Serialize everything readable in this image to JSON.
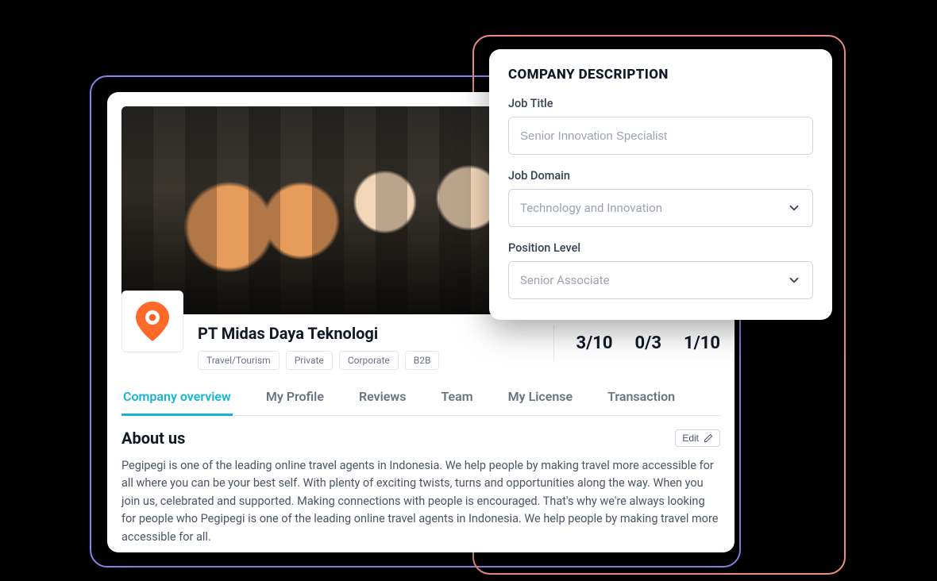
{
  "company": {
    "name": "PT Midas Daya Teknologi",
    "tags": [
      "Travel/Tourism",
      "Private",
      "Corporate",
      "B2B"
    ]
  },
  "stats": {
    "a": "3/10",
    "b": "0/3",
    "c": "1/10"
  },
  "tabs": {
    "overview": "Company overview",
    "profile": "My Profile",
    "reviews": "Reviews",
    "team": "Team",
    "license": "My License",
    "transaction": "Transaction"
  },
  "about": {
    "title": "About us",
    "edit_label": "Edit",
    "body": "Pegipegi is one of the leading online travel agents in Indonesia. We help people by making travel more accessible for all where you can be your best self. With plenty of exciting twists, turns and opportunities along the way. When you join us, celebrated and supported. Making connections with people is encouraged. That's why we're always looking for people who Pegipegi is one of the leading online travel agents in Indonesia. We help people by making travel more accessible for all."
  },
  "overlay": {
    "title": "COMPANY DESCRIPTION",
    "job_title_label": "Job Title",
    "job_title_placeholder": "Senior Innovation Specialist",
    "job_domain_label": "Job Domain",
    "job_domain_value": "Technology and Innovation",
    "position_level_label": "Position Level",
    "position_level_value": "Senior Associate"
  }
}
